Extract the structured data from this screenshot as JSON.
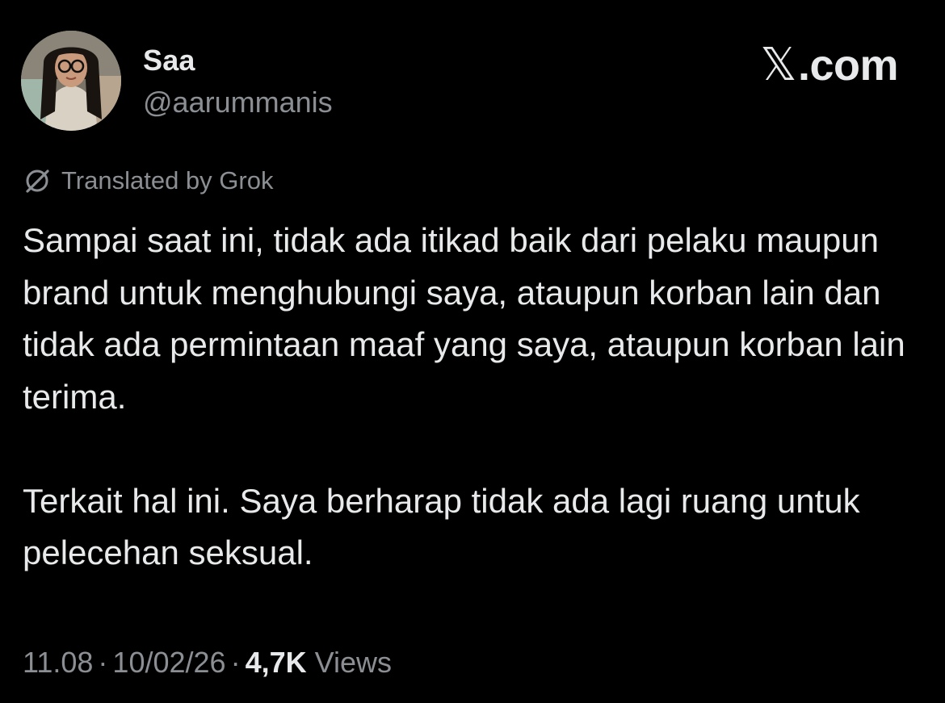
{
  "user": {
    "display_name": "Saa",
    "handle": "@aarummanis"
  },
  "brand": {
    "x_glyph": "𝕏",
    "suffix": ".com"
  },
  "translation": {
    "label": "Translated by Grok",
    "icon": "grok-icon"
  },
  "tweet": {
    "paragraphs": [
      "Sampai saat ini, tidak ada itikad baik dari pelaku maupun brand untuk menghubungi saya, ataupun korban lain dan tidak ada permintaan maaf yang saya, ataupun korban lain terima.",
      "Terkait hal ini. Saya berharap tidak ada lagi ruang untuk pelecehan seksual."
    ]
  },
  "meta": {
    "time": "11.08",
    "date": "10/02/26",
    "separator": "·",
    "views_count": "4,7K",
    "views_label": "Views"
  },
  "colors": {
    "background": "#000000",
    "primary_text": "#e7e9ea",
    "secondary_text": "#8b8f94"
  }
}
